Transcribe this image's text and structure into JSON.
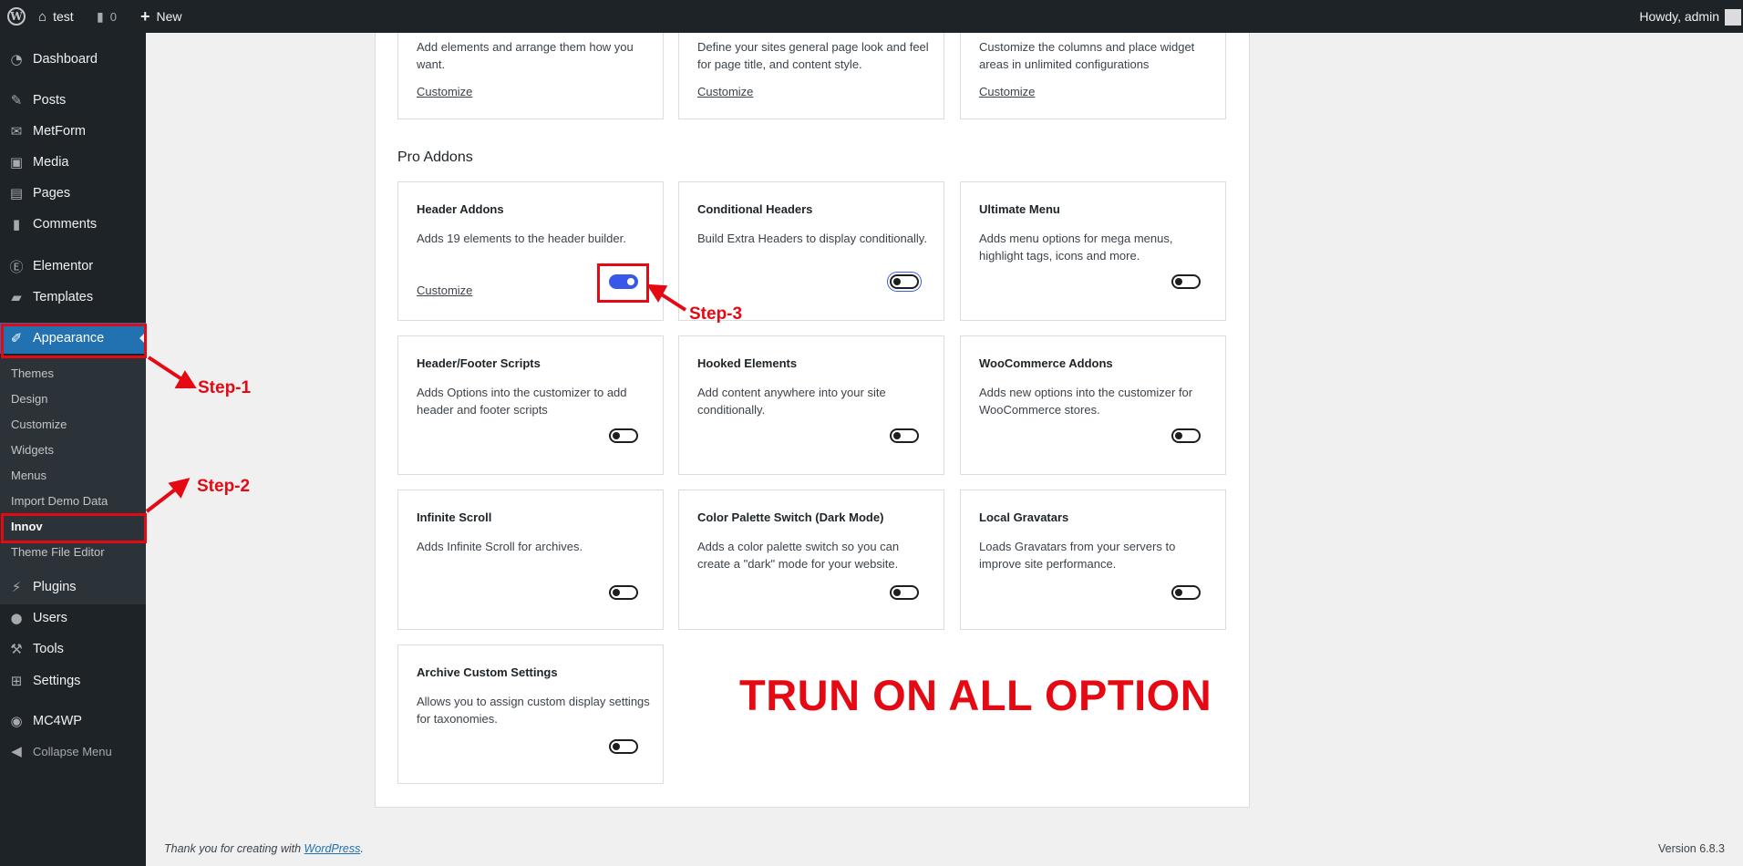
{
  "admin_bar": {
    "site_name": "test",
    "comments_count": "0",
    "new_label": "New",
    "howdy": "Howdy, admin"
  },
  "sidebar": {
    "items": [
      {
        "label": "Dashboard",
        "icon": "dashboard-icon"
      },
      {
        "label": "Posts",
        "icon": "pin-icon"
      },
      {
        "label": "MetForm",
        "icon": "form-icon"
      },
      {
        "label": "Media",
        "icon": "media-icon"
      },
      {
        "label": "Pages",
        "icon": "pages-icon"
      },
      {
        "label": "Comments",
        "icon": "comment-icon"
      },
      {
        "label": "Elementor",
        "icon": "elementor-icon"
      },
      {
        "label": "Templates",
        "icon": "folder-icon"
      },
      {
        "label": "Appearance",
        "icon": "brush-icon"
      },
      {
        "label": "Plugins",
        "icon": "plugin-icon"
      },
      {
        "label": "Users",
        "icon": "user-icon"
      },
      {
        "label": "Tools",
        "icon": "wrench-icon"
      },
      {
        "label": "Settings",
        "icon": "settings-icon"
      },
      {
        "label": "MC4WP",
        "icon": "mc4wp-icon"
      },
      {
        "label": "Collapse Menu",
        "icon": "collapse-icon"
      }
    ],
    "submenu": [
      "Themes",
      "Design",
      "Customize",
      "Widgets",
      "Menus",
      "Import Demo Data",
      "Innov",
      "Theme File Editor"
    ]
  },
  "top_cards": [
    {
      "desc": "Add elements and arrange them how you want.",
      "link": "Customize"
    },
    {
      "desc": "Define your sites general page look and feel for page title, and content style.",
      "link": "Customize"
    },
    {
      "desc": "Customize the columns and place widget areas in unlimited configurations",
      "link": "Customize"
    }
  ],
  "section_title": "Pro Addons",
  "addons": [
    {
      "title": "Header Addons",
      "desc": "Adds 19 elements to the header builder.",
      "link": "Customize",
      "enabled": true
    },
    {
      "title": "Conditional Headers",
      "desc": "Build Extra Headers to display conditionally.",
      "enabled": false
    },
    {
      "title": "Ultimate Menu",
      "desc": "Adds menu options for mega menus, highlight tags, icons and more.",
      "enabled": false
    },
    {
      "title": "Header/Footer Scripts",
      "desc": "Adds Options into the customizer to add header and footer scripts",
      "enabled": false
    },
    {
      "title": "Hooked Elements",
      "desc": "Add content anywhere into your site conditionally.",
      "enabled": false
    },
    {
      "title": "WooCommerce Addons",
      "desc": "Adds new options into the customizer for WooCommerce stores.",
      "enabled": false
    },
    {
      "title": "Infinite Scroll",
      "desc": "Adds Infinite Scroll for archives.",
      "enabled": false
    },
    {
      "title": "Color Palette Switch (Dark Mode)",
      "desc": "Adds a color palette switch so you can create a \"dark\" mode for your website.",
      "enabled": false
    },
    {
      "title": "Local Gravatars",
      "desc": "Loads Gravatars from your servers to improve site performance.",
      "enabled": false
    },
    {
      "title": "Archive Custom Settings",
      "desc": "Allows you to assign custom display settings for taxonomies.",
      "enabled": false
    }
  ],
  "annotations": {
    "step1": "Step-1",
    "step2": "Step-2",
    "step3": "Step-3",
    "note": "TRUN ON ALL OPTION",
    "color": "#e50914"
  },
  "footer": {
    "thanks_prefix": "Thank you for creating with ",
    "wordpress_link": "WordPress",
    "thanks_suffix": ".",
    "version": "Version 6.8.3"
  },
  "colors": {
    "admin_bar": "#1d2327",
    "active_menu": "#2271b1",
    "toggle_on": "#3858e9"
  }
}
